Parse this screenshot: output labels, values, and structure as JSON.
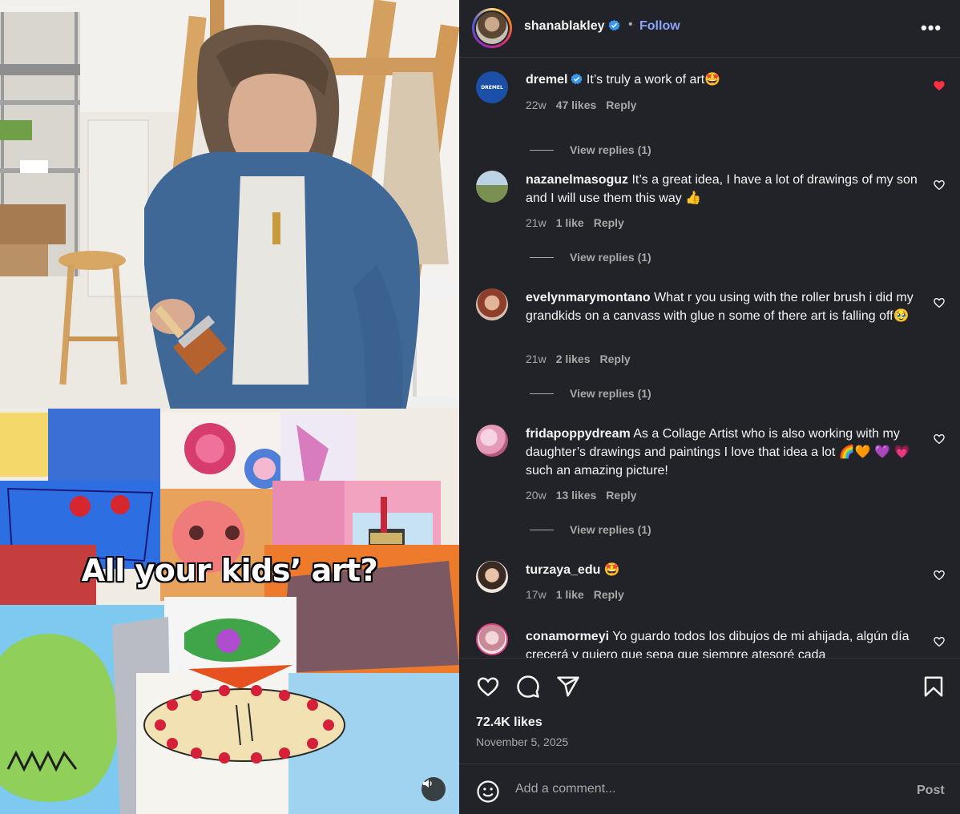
{
  "post": {
    "caption_overlay": "All your kids’ art?",
    "author": {
      "username": "shanablakley",
      "verified": true,
      "follow_label": "Follow",
      "separator": "•"
    },
    "more_label": "•••"
  },
  "comments": [
    {
      "username": "dremel",
      "verified": true,
      "text": "It’s truly a work of art🤩",
      "age": "22w",
      "likes": "47 likes",
      "reply_label": "Reply",
      "liked": true,
      "view_replies": "View replies (1)",
      "avatar_text": "DREMEL"
    },
    {
      "username": "nazanelmasoguz",
      "verified": false,
      "text": "It’s a great idea, I have a lot of drawings of my son and I will use them this way 👍",
      "age": "21w",
      "likes": "1 like",
      "reply_label": "Reply",
      "liked": false,
      "view_replies": "View replies (1)"
    },
    {
      "username": "evelynmarymontano",
      "verified": false,
      "text": "What r you using with the roller brush i did my grandkids on a canvass with glue n some of there art is falling off🥹",
      "age": "21w",
      "likes": "2 likes",
      "reply_label": "Reply",
      "liked": false,
      "view_replies": "View replies (1)"
    },
    {
      "username": "fridapoppydream",
      "verified": false,
      "text": "As a Collage Artist who is also working with my daughter’s drawings and paintings I love that idea a lot 🌈🧡 💜 💗 such an amazing picture!",
      "age": "20w",
      "likes": "13 likes",
      "reply_label": "Reply",
      "liked": false,
      "view_replies": "View replies (1)"
    },
    {
      "username": "turzaya_edu",
      "verified": false,
      "text": "🤩",
      "age": "17w",
      "likes": "1 like",
      "reply_label": "Reply",
      "liked": false
    },
    {
      "username": "conamormeyi",
      "verified": false,
      "text": "Yo guardo todos los dibujos de mi ahijada, algún día crecerá y quiero que sepa que siempre atesoré cada",
      "liked": false
    }
  ],
  "footer": {
    "likes_count": "72.4K likes",
    "date": "November 5, 2025",
    "comment_placeholder": "Add a comment...",
    "post_label": "Post"
  },
  "icons": {
    "like": "heart-icon",
    "comment": "comment-icon",
    "share": "share-icon",
    "save": "bookmark-icon",
    "emoji": "emoji-icon",
    "mute": "speaker-icon",
    "verified": "verified-badge-icon"
  },
  "colors": {
    "panel_bg": "#212328",
    "accent_follow": "#8aa4ff",
    "verified": "#3897f0",
    "liked_heart": "#ff3040",
    "muted_text": "#a8a8a8"
  }
}
